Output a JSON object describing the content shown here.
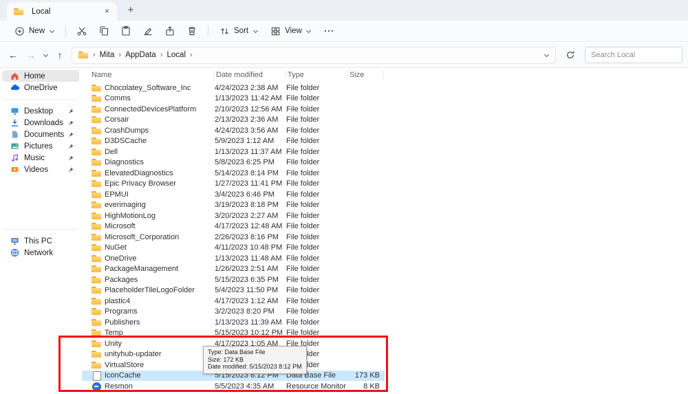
{
  "window": {
    "tab_title": "Local",
    "close_glyph": "×",
    "new_tab_glyph": "+"
  },
  "toolbar": {
    "new_label": "New",
    "sort_label": "Sort",
    "view_label": "View",
    "icons": [
      "plus",
      "cut",
      "copy",
      "paste",
      "rename",
      "share",
      "delete",
      "sort",
      "view",
      "more"
    ]
  },
  "navbar": {
    "back_glyph": "←",
    "forward_glyph": "→",
    "up_glyph": "↑",
    "crumb_separator": "›",
    "breadcrumb": [
      "Mita",
      "AppData",
      "Local"
    ],
    "search_placeholder": "Search Local"
  },
  "sidebar": {
    "items": [
      {
        "label": "Home",
        "icon": "home-icon",
        "pinned": false,
        "selected": true
      },
      {
        "label": "OneDrive",
        "icon": "onedrive-icon",
        "pinned": false,
        "selected": false
      },
      {
        "label": "Desktop",
        "icon": "desktop-icon",
        "pinned": true,
        "selected": false
      },
      {
        "label": "Downloads",
        "icon": "downloads-icon",
        "pinned": true,
        "selected": false
      },
      {
        "label": "Documents",
        "icon": "documents-icon",
        "pinned": true,
        "selected": false
      },
      {
        "label": "Pictures",
        "icon": "pictures-icon",
        "pinned": true,
        "selected": false
      },
      {
        "label": "Music",
        "icon": "music-icon",
        "pinned": true,
        "selected": false
      },
      {
        "label": "Videos",
        "icon": "videos-icon",
        "pinned": true,
        "selected": false
      },
      {
        "label": "This PC",
        "icon": "this-pc-icon",
        "pinned": false,
        "selected": false
      },
      {
        "label": "Network",
        "icon": "network-icon",
        "pinned": false,
        "selected": false
      }
    ]
  },
  "filelist": {
    "columns": [
      "Name",
      "Date modified",
      "Type",
      "Size"
    ],
    "rows": [
      {
        "name": "Chocolatey_Software_Inc",
        "date": "4/24/2023 2:38 AM",
        "type": "File folder",
        "size": "",
        "icon": "folder",
        "selected": false
      },
      {
        "name": "Comms",
        "date": "1/13/2023 11:42 AM",
        "type": "File folder",
        "size": "",
        "icon": "folder",
        "selected": false
      },
      {
        "name": "ConnectedDevicesPlatform",
        "date": "2/10/2023 12:56 AM",
        "type": "File folder",
        "size": "",
        "icon": "folder",
        "selected": false
      },
      {
        "name": "Corsair",
        "date": "2/13/2023 2:36 AM",
        "type": "File folder",
        "size": "",
        "icon": "folder",
        "selected": false
      },
      {
        "name": "CrashDumps",
        "date": "4/24/2023 3:56 AM",
        "type": "File folder",
        "size": "",
        "icon": "folder",
        "selected": false
      },
      {
        "name": "D3DSCache",
        "date": "5/9/2023 1:12 AM",
        "type": "File folder",
        "size": "",
        "icon": "folder",
        "selected": false
      },
      {
        "name": "Dell",
        "date": "1/13/2023 11:37 AM",
        "type": "File folder",
        "size": "",
        "icon": "folder",
        "selected": false
      },
      {
        "name": "Diagnostics",
        "date": "5/8/2023 6:25 PM",
        "type": "File folder",
        "size": "",
        "icon": "folder",
        "selected": false
      },
      {
        "name": "ElevatedDiagnostics",
        "date": "5/14/2023 8:14 PM",
        "type": "File folder",
        "size": "",
        "icon": "folder",
        "selected": false
      },
      {
        "name": "Epic Privacy Browser",
        "date": "1/27/2023 11:41 PM",
        "type": "File folder",
        "size": "",
        "icon": "folder",
        "selected": false
      },
      {
        "name": "EPMUI",
        "date": "3/4/2023 6:46 PM",
        "type": "File folder",
        "size": "",
        "icon": "folder",
        "selected": false
      },
      {
        "name": "everimaging",
        "date": "3/19/2023 8:18 PM",
        "type": "File folder",
        "size": "",
        "icon": "folder",
        "selected": false
      },
      {
        "name": "HighMotionLog",
        "date": "3/20/2023 2:27 AM",
        "type": "File folder",
        "size": "",
        "icon": "folder",
        "selected": false
      },
      {
        "name": "Microsoft",
        "date": "4/17/2023 12:48 AM",
        "type": "File folder",
        "size": "",
        "icon": "folder",
        "selected": false
      },
      {
        "name": "Microsoft_Corporation",
        "date": "2/26/2023 8:16 PM",
        "type": "File folder",
        "size": "",
        "icon": "folder",
        "selected": false
      },
      {
        "name": "NuGet",
        "date": "4/11/2023 10:48 PM",
        "type": "File folder",
        "size": "",
        "icon": "folder",
        "selected": false
      },
      {
        "name": "OneDrive",
        "date": "1/13/2023 11:48 AM",
        "type": "File folder",
        "size": "",
        "icon": "folder",
        "selected": false
      },
      {
        "name": "PackageManagement",
        "date": "1/26/2023 2:51 AM",
        "type": "File folder",
        "size": "",
        "icon": "folder",
        "selected": false
      },
      {
        "name": "Packages",
        "date": "5/15/2023 6:35 PM",
        "type": "File folder",
        "size": "",
        "icon": "folder",
        "selected": false
      },
      {
        "name": "PlaceholderTileLogoFolder",
        "date": "5/4/2023 11:50 PM",
        "type": "File folder",
        "size": "",
        "icon": "folder",
        "selected": false
      },
      {
        "name": "plastic4",
        "date": "4/17/2023 1:12 AM",
        "type": "File folder",
        "size": "",
        "icon": "folder",
        "selected": false
      },
      {
        "name": "Programs",
        "date": "3/2/2023 8:20 PM",
        "type": "File folder",
        "size": "",
        "icon": "folder",
        "selected": false
      },
      {
        "name": "Publishers",
        "date": "1/13/2023 11:39 AM",
        "type": "File folder",
        "size": "",
        "icon": "folder",
        "selected": false
      },
      {
        "name": "Temp",
        "date": "5/15/2023 10:12 PM",
        "type": "File folder",
        "size": "",
        "icon": "folder",
        "selected": false
      },
      {
        "name": "Unity",
        "date": "4/17/2023 1:05 AM",
        "type": "File folder",
        "size": "",
        "icon": "folder",
        "selected": false
      },
      {
        "name": "unityhub-updater",
        "date": "",
        "type": "File folder",
        "size": "",
        "icon": "folder",
        "selected": false
      },
      {
        "name": "VirtualStore",
        "date": "",
        "type": "File folder",
        "size": "",
        "icon": "folder",
        "selected": false
      },
      {
        "name": "IconCache",
        "date": "5/15/2023 8:12 PM",
        "type": "Data Base File",
        "size": "173 KB",
        "icon": "database-file",
        "selected": true
      },
      {
        "name": "Resmon",
        "date": "5/5/2023 4:35 AM",
        "type": "Resource Monitor ...",
        "size": "8 KB",
        "icon": "resmon-file",
        "selected": false
      }
    ]
  },
  "tooltip": {
    "lines": [
      "Type: Data Base File",
      "Size: 172 KB",
      "Date modified: 5/15/2023 8:12 PM"
    ]
  },
  "colors": {
    "selection": "#cce8ff",
    "folder": "#ffd977",
    "annotation": "#ee1111"
  }
}
